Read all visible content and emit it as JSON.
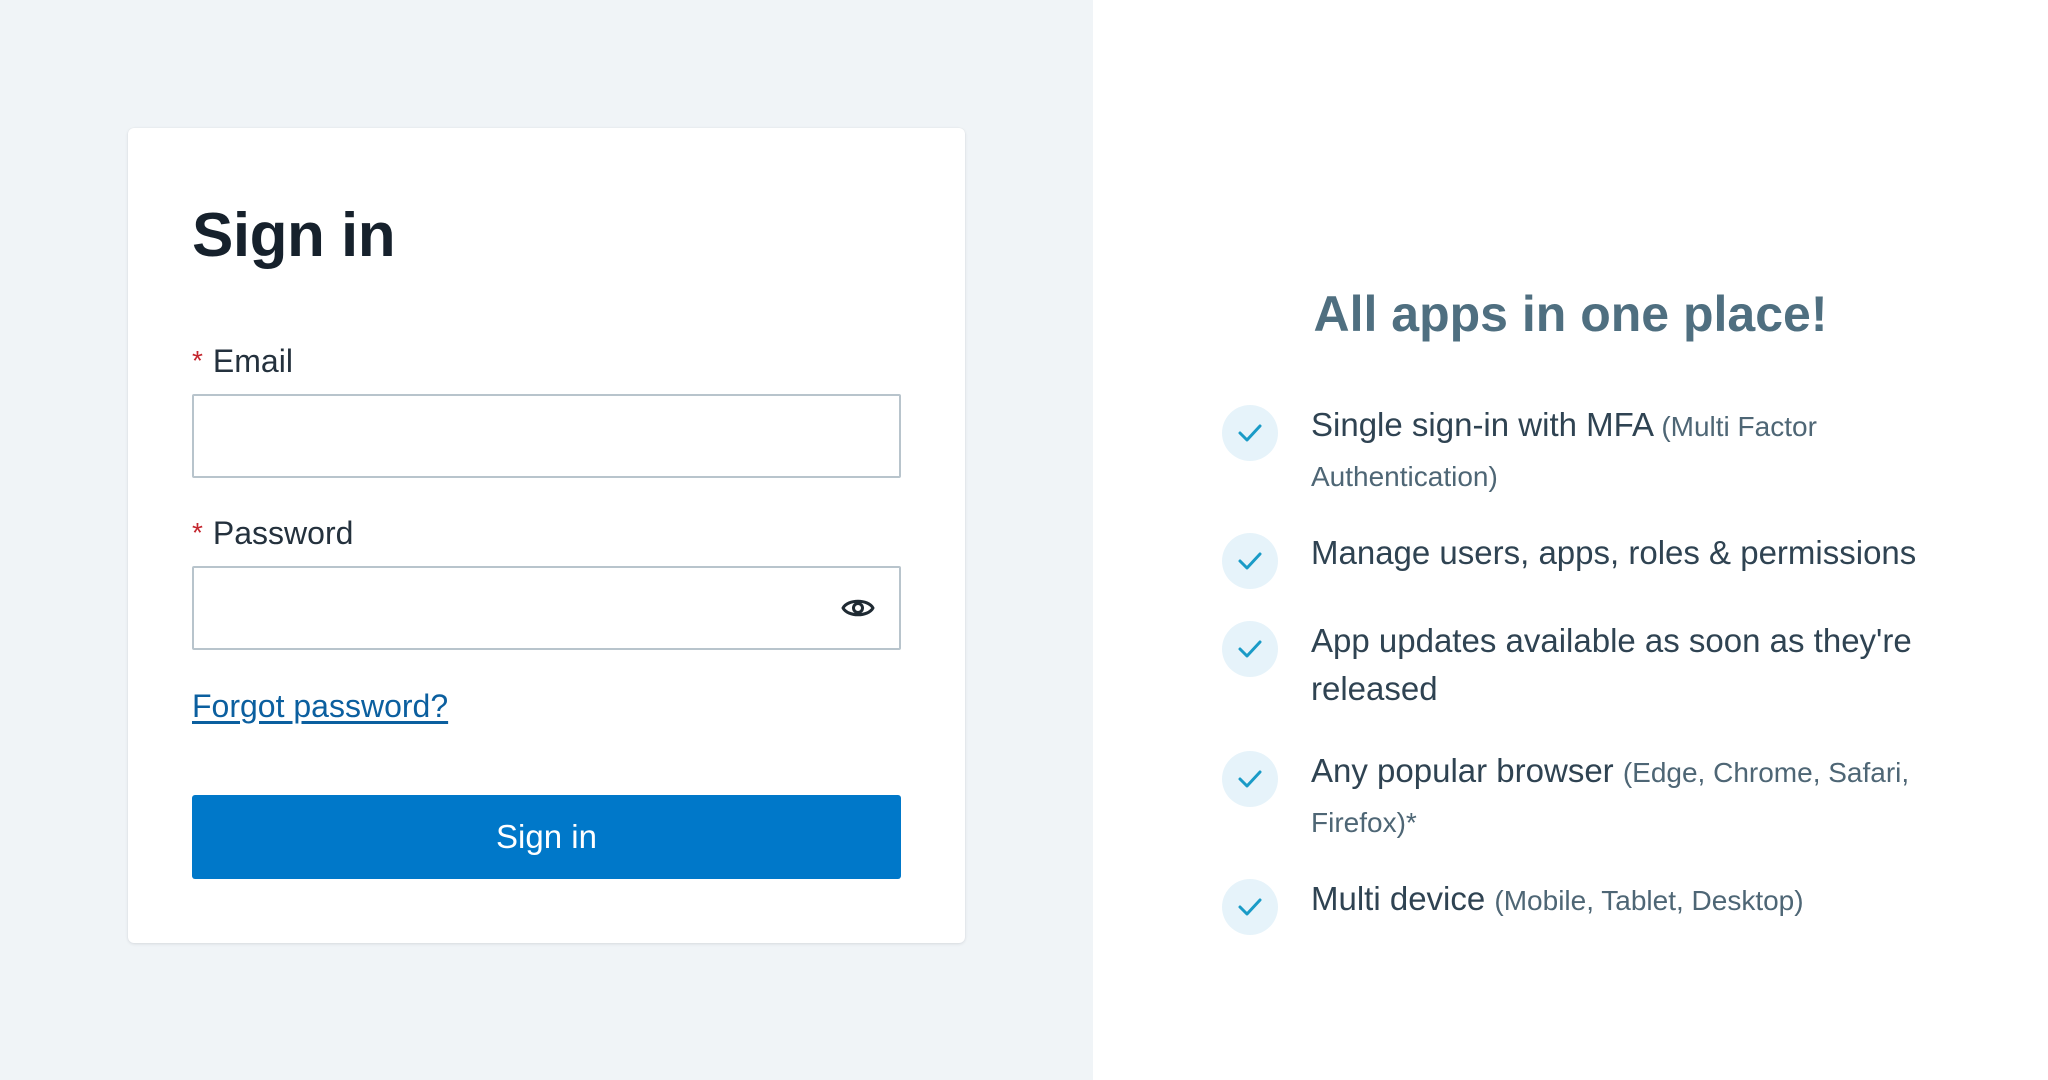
{
  "signin_card": {
    "title": "Sign in",
    "email": {
      "required_marker": "*",
      "label": "Email",
      "value": "",
      "placeholder": ""
    },
    "password": {
      "required_marker": "*",
      "label": "Password",
      "value": "",
      "placeholder": "",
      "toggle_icon": "eye-icon"
    },
    "forgot_link": "Forgot password?",
    "submit_label": "Sign in"
  },
  "promo": {
    "title": "All apps in one place!",
    "features": [
      {
        "icon": "check-icon",
        "text": "Single sign-in with MFA",
        "note": "(Multi Factor Authentication)"
      },
      {
        "icon": "check-icon",
        "text": "Manage users, apps, roles & permissions",
        "note": ""
      },
      {
        "icon": "check-icon",
        "text": "App updates available as soon as they're released",
        "note": ""
      },
      {
        "icon": "check-icon",
        "text": "Any popular browser",
        "note": "(Edge, Chrome, Safari, Firefox)*"
      },
      {
        "icon": "check-icon",
        "text": "Multi device",
        "note": "(Mobile, Tablet, Desktop)"
      }
    ]
  },
  "colors": {
    "left_background": "#f0f4f7",
    "primary_button": "#0078c9",
    "link": "#0b5f9f",
    "required_marker": "#c4262e",
    "check_circle": "#e6f3fa",
    "check_mark": "#1a9bc7",
    "promo_title": "#4f6f80"
  }
}
